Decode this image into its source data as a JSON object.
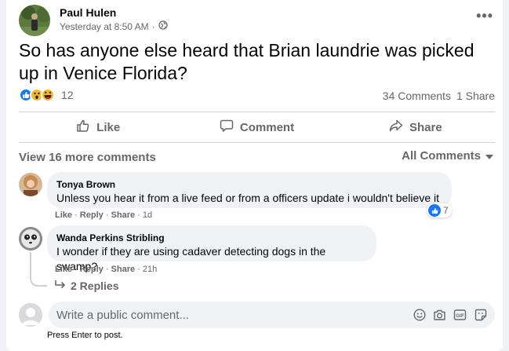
{
  "post": {
    "author": "Paul Hulen",
    "timestamp": "Yesterday at 8:50 AM",
    "separator": "·",
    "privacy_icon": "globe-icon",
    "text": "So has anyone else heard that Brian laundrie was picked up in Venice Florida?",
    "reaction_icons": [
      "like-icon",
      "wow-icon",
      "haha-icon"
    ],
    "reaction_count": "12",
    "comments_count": "34 Comments",
    "shares_count": "1 Share"
  },
  "actions": {
    "like": "Like",
    "comment": "Comment",
    "share": "Share"
  },
  "comments_section": {
    "view_more": "View 16 more comments",
    "sort": "All Comments"
  },
  "comments": [
    {
      "name": "Tonya Brown",
      "text": "Unless you hear it from a live feed or from a officers update i wouldn't believe it",
      "like": "Like",
      "reply": "Reply",
      "share": "Share",
      "time": "1d",
      "reaction_count": "7"
    },
    {
      "name": "Wanda Perkins Stribling",
      "text": "I wonder if they are using cadaver detecting dogs in the swamp?",
      "like": "Like",
      "reply": "Reply",
      "share": "Share",
      "time": "21h",
      "replies": "2 Replies"
    }
  ],
  "composer": {
    "placeholder": "Write a public comment...",
    "hint": "Press Enter to post.",
    "icons": [
      "emoji-icon",
      "camera-icon",
      "gif-icon",
      "sticker-icon"
    ]
  },
  "colors": {
    "secondary_text": "#65676b",
    "like_blue": "#1877f2",
    "bubble_bg": "#f0f2f5"
  }
}
